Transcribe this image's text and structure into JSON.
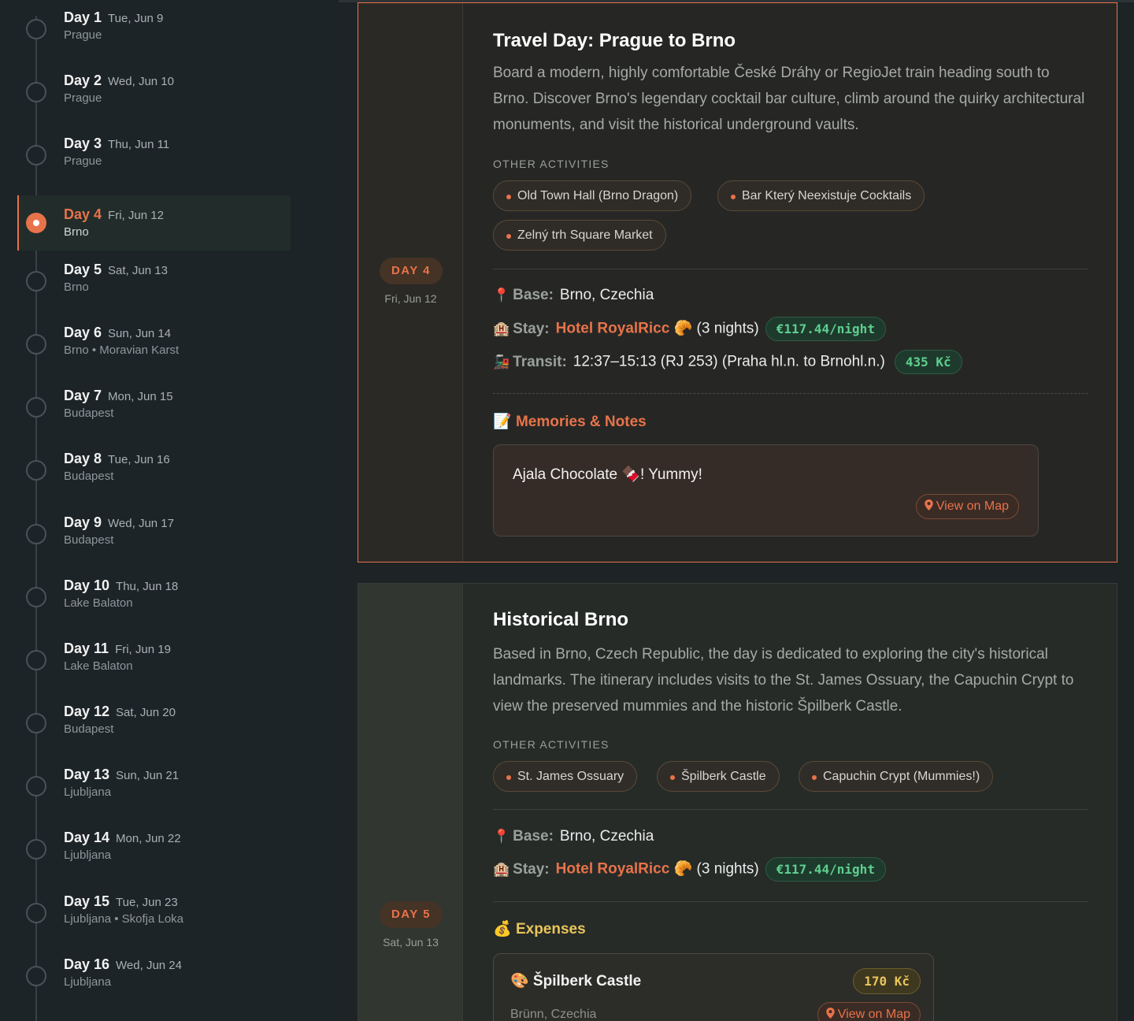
{
  "sidebar": {
    "days": [
      {
        "name": "Day 1",
        "date": "Tue, Jun 9",
        "location": "Prague"
      },
      {
        "name": "Day 2",
        "date": "Wed, Jun 10",
        "location": "Prague"
      },
      {
        "name": "Day 3",
        "date": "Thu, Jun 11",
        "location": "Prague"
      },
      {
        "name": "Day 4",
        "date": "Fri, Jun 12",
        "location": "Brno"
      },
      {
        "name": "Day 5",
        "date": "Sat, Jun 13",
        "location": "Brno"
      },
      {
        "name": "Day 6",
        "date": "Sun, Jun 14",
        "location": "Brno • Moravian Karst"
      },
      {
        "name": "Day 7",
        "date": "Mon, Jun 15",
        "location": "Budapest"
      },
      {
        "name": "Day 8",
        "date": "Tue, Jun 16",
        "location": "Budapest"
      },
      {
        "name": "Day 9",
        "date": "Wed, Jun 17",
        "location": "Budapest"
      },
      {
        "name": "Day 10",
        "date": "Thu, Jun 18",
        "location": "Lake Balaton"
      },
      {
        "name": "Day 11",
        "date": "Fri, Jun 19",
        "location": "Lake Balaton"
      },
      {
        "name": "Day 12",
        "date": "Sat, Jun 20",
        "location": "Budapest"
      },
      {
        "name": "Day 13",
        "date": "Sun, Jun 21",
        "location": "Ljubljana"
      },
      {
        "name": "Day 14",
        "date": "Mon, Jun 22",
        "location": "Ljubljana"
      },
      {
        "name": "Day 15",
        "date": "Tue, Jun 23",
        "location": "Ljubljana • Skofja Loka"
      },
      {
        "name": "Day 16",
        "date": "Wed, Jun 24",
        "location": "Ljubljana"
      }
    ]
  },
  "day4": {
    "badge": "DAY 4",
    "date": "Fri, Jun 12",
    "title": "Travel Day: Prague to Brno",
    "description": "Board a modern, highly comfortable České Dráhy or RegioJet train heading south to Brno. Discover Brno's legendary cocktail bar culture, climb around the quirky architectural monuments, and visit the historical underground vaults.",
    "activities_label": "OTHER ACTIVITIES",
    "activities": [
      "Old Town Hall (Brno Dragon)",
      "Bar Který Neexistuje Cocktails",
      "Zelný trh Square Market"
    ],
    "base_label": "Base:",
    "base_value": "Brno, Czechia",
    "stay_label": "Stay:",
    "hotel": "Hotel RoyalRicc 🥐",
    "nights": "(3 nights)",
    "price": "€117.44/night",
    "transit_label": "Transit:",
    "transit_value": "12:37–15:13 (RJ 253) (Praha hl.n. to Brnohl.n.)",
    "transit_price": "435 Kč",
    "notes_title": "Memories & Notes",
    "note_text": "Ajala Chocolate 🍫! Yummy!",
    "map_button": "View on Map"
  },
  "day5": {
    "badge": "DAY 5",
    "date": "Sat, Jun 13",
    "title": "Historical Brno",
    "description": "Based in Brno, Czech Republic, the day is dedicated to exploring the city's historical landmarks. The itinerary includes visits to the St. James Ossuary, the Capuchin Crypt to view the preserved mummies and the historic Špilberk Castle.",
    "activities_label": "OTHER ACTIVITIES",
    "activities": [
      "St. James Ossuary",
      "Špilberk Castle",
      "Capuchin Crypt (Mummies!)"
    ],
    "base_label": "Base:",
    "base_value": "Brno, Czechia",
    "stay_label": "Stay:",
    "hotel": "Hotel RoyalRicc 🥐",
    "nights": "(3 nights)",
    "price": "€117.44/night",
    "expenses_title": "Expenses",
    "expense_title": "🎨 Špilberk Castle",
    "expense_cost": "170 Kč",
    "expense_location": "Brünn, Czechia",
    "map_button": "View on Map"
  },
  "icons": {
    "pin": "📍",
    "hotel": "🏨",
    "train": "🚂",
    "memo": "📝",
    "money": "💰"
  },
  "colors": {
    "accent": "#e8734a",
    "price_green": "#5fcf8e",
    "expense_gold": "#e9c55a"
  }
}
